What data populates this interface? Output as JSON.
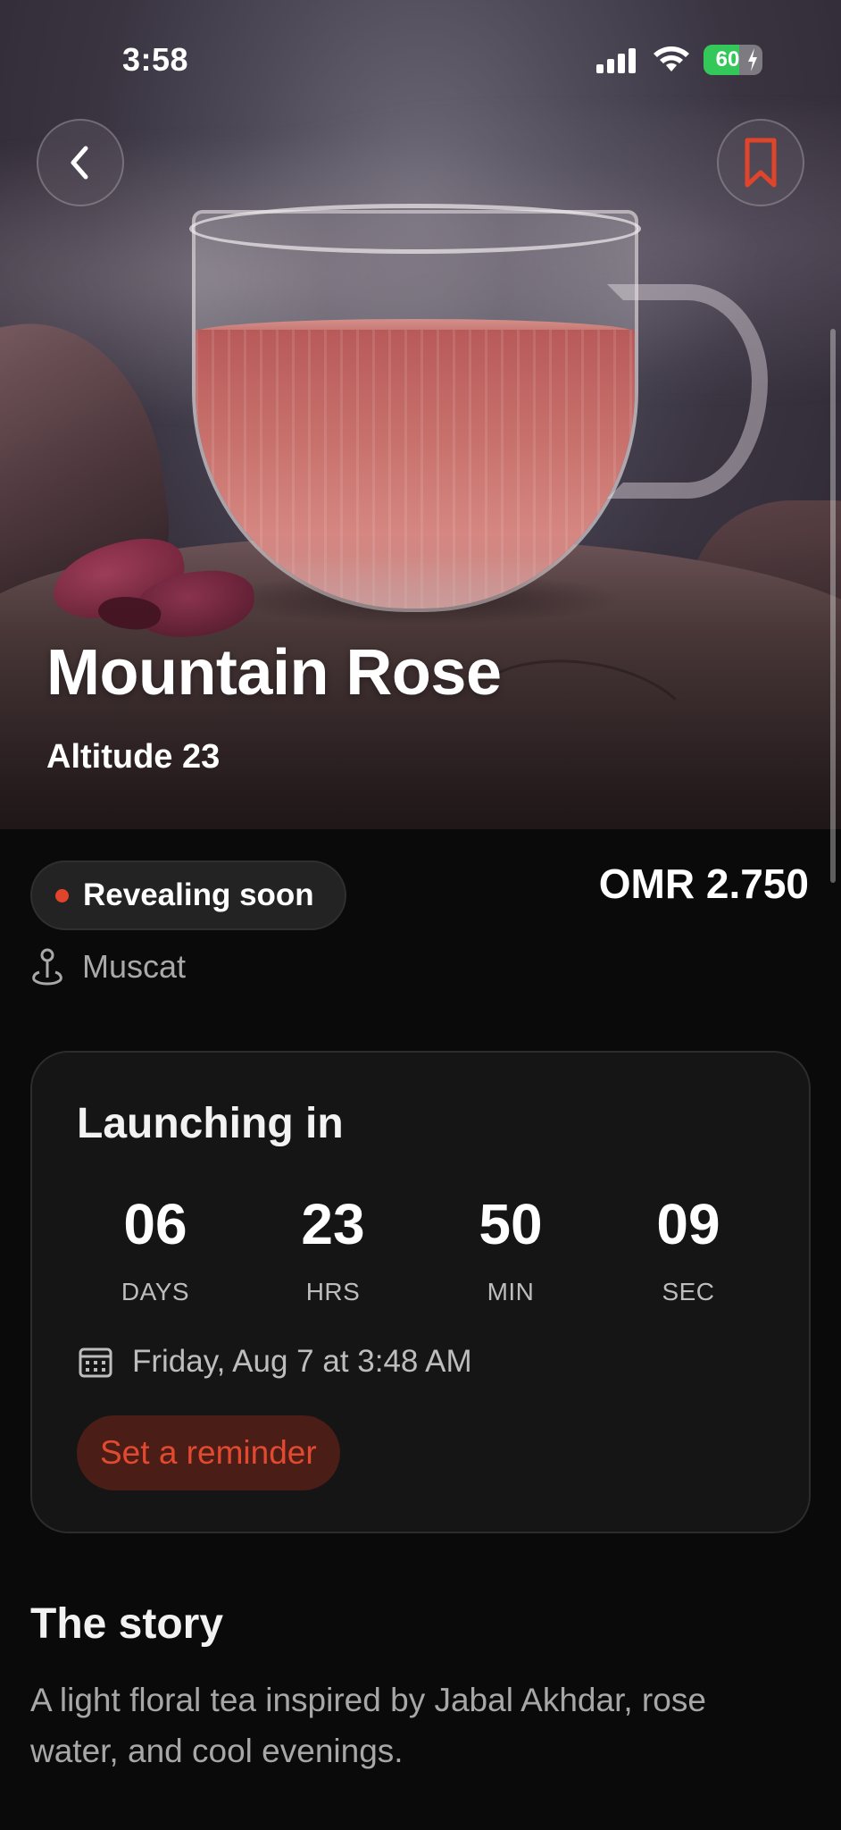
{
  "status_bar": {
    "time": "3:58",
    "battery_percent": "60",
    "battery_level": 0.6,
    "battery_color": "#34c759"
  },
  "hero": {
    "title": "Mountain Rose",
    "subtitle": "Altitude 23",
    "back_icon": "chevron-left-icon",
    "bookmark_icon": "bookmark-icon",
    "accent_color": "#e0452b"
  },
  "product": {
    "status": "Revealing soon",
    "price": "OMR 2.750",
    "location": "Muscat"
  },
  "countdown": {
    "title": "Launching in",
    "units": [
      {
        "value": "06",
        "label": "DAYS"
      },
      {
        "value": "23",
        "label": "HRS"
      },
      {
        "value": "50",
        "label": "MIN"
      },
      {
        "value": "09",
        "label": "SEC"
      }
    ],
    "date": "Friday, Aug 7 at 3:48 AM",
    "reminder_label": "Set a reminder"
  },
  "story": {
    "title": "The story",
    "text": "A light floral tea inspired by Jabal Akhdar, rose water, and cool evenings."
  }
}
